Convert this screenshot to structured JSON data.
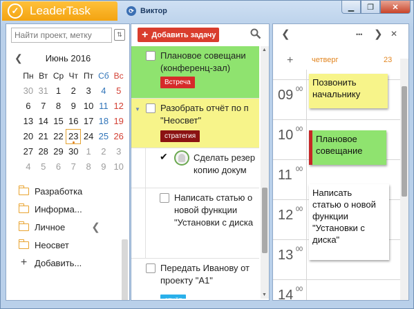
{
  "app": {
    "brand": "LeaderTask",
    "user": "Виктор"
  },
  "window_buttons": {
    "minimize": "▁",
    "restore": "❐",
    "close": "✕"
  },
  "sidebar": {
    "search_placeholder": "Найти проект, метку",
    "calendar": {
      "month_label": "Июнь 2016",
      "prev_label": "❮",
      "weekdays": [
        "Пн",
        "Вт",
        "Ср",
        "Чт",
        "Пт",
        "Сб",
        "Вс"
      ],
      "weeks": [
        [
          "30",
          "31",
          "1",
          "2",
          "3",
          "4",
          "5"
        ],
        [
          "6",
          "7",
          "8",
          "9",
          "10",
          "11",
          "12"
        ],
        [
          "13",
          "14",
          "15",
          "16",
          "17",
          "18",
          "19"
        ],
        [
          "20",
          "21",
          "22",
          "23",
          "24",
          "25",
          "26"
        ],
        [
          "27",
          "28",
          "29",
          "30",
          "1",
          "2",
          "3"
        ],
        [
          "4",
          "5",
          "6",
          "7",
          "8",
          "9",
          "10"
        ]
      ],
      "selected_day": "23"
    },
    "projects": [
      {
        "label": "Разработка"
      },
      {
        "label": "Информа..."
      },
      {
        "label": "Личное",
        "chevron": "❮"
      },
      {
        "label": "Неосвет"
      }
    ],
    "add_label": "Добавить..."
  },
  "tasks_panel": {
    "add_task_label": "Добавить задачу",
    "add_task_icon": "+",
    "tasks": [
      {
        "lines": [
          "Плановое совещани",
          "(конференц-зал)"
        ],
        "tag": "Встреча",
        "tag_color": "#d62a2a",
        "bg": "#8fe36f"
      },
      {
        "lines": [
          "Разобрать отчёт по п",
          "\"Неосвет\""
        ],
        "tag": "стратегия",
        "tag_color": "#8b1212",
        "bg": "#f7f48a",
        "expander": "▼"
      },
      {
        "lines": [
          "Сделать резер",
          "копию докум"
        ],
        "checked": true,
        "check_glyph": "✔",
        "bg": "#ffffff"
      },
      {
        "lines": [
          "Написать статью о",
          "новой функции",
          "\"Установки с диска"
        ],
        "bg": "#ffffff"
      },
      {
        "lines": [
          "Передать Иванову от",
          "проекту \"А1\""
        ],
        "tag": "отчёт",
        "tag_color": "#2ab0ea",
        "bg": "#ffffff"
      }
    ]
  },
  "day_view": {
    "nav_prev": "❮",
    "nav_more": "•••",
    "nav_next": "❯",
    "nav_close": "✕",
    "add": "+",
    "day_name": "четверг",
    "day_number": "23",
    "hours": [
      {
        "h": "09",
        "m": "00"
      },
      {
        "h": "10",
        "m": "00"
      },
      {
        "h": "11",
        "m": "00"
      },
      {
        "h": "12",
        "m": "00"
      },
      {
        "h": "13",
        "m": "00"
      },
      {
        "h": "14",
        "m": "00"
      }
    ],
    "events": [
      {
        "lines": [
          "Позвонить",
          "начальнику"
        ],
        "bg": "#f7f48a"
      },
      {
        "lines": [
          "Плановое",
          "совещание"
        ],
        "bg": "#8fe36f",
        "accent": "#c62626"
      },
      {
        "lines": [
          "Написать",
          "статью о новой",
          "функции",
          "\"Установки с",
          "диска\""
        ],
        "bg": "#ffffff"
      }
    ]
  }
}
